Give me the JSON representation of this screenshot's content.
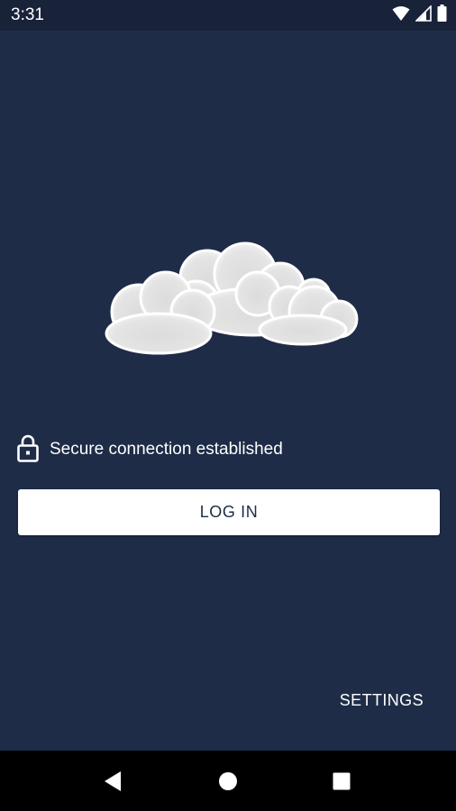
{
  "status_bar": {
    "time": "3:31",
    "icons": [
      "wifi-icon",
      "cellular-signal-icon",
      "battery-icon"
    ]
  },
  "logo": {
    "icon": "cloud-logo",
    "colors": {
      "cloud_fill": "#e6e6e6",
      "cloud_edge": "#ffffff"
    }
  },
  "security": {
    "icon": "lock-icon",
    "status_text": "Secure connection established"
  },
  "actions": {
    "login_label": "LOG IN",
    "settings_label": "SETTINGS"
  },
  "nav_bar": {
    "buttons": [
      "back-icon",
      "home-icon",
      "recents-icon"
    ]
  },
  "colors": {
    "background": "#1e2c47",
    "status_bar": "#18233a",
    "button_background": "#ffffff",
    "button_text": "#1e2c47"
  }
}
